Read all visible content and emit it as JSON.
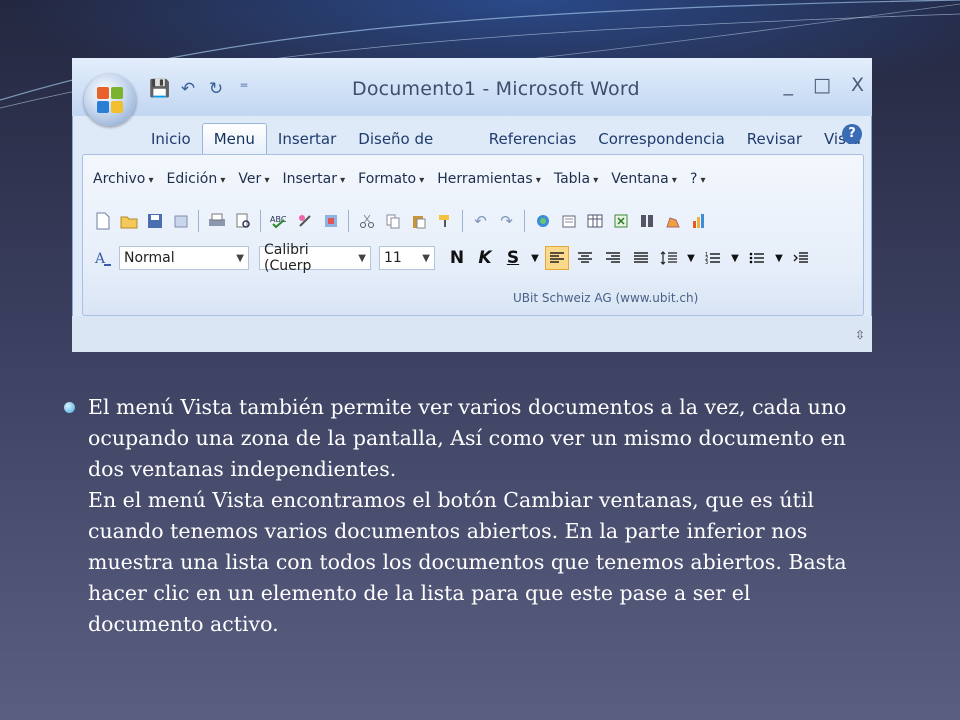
{
  "window": {
    "title": "Documento1 - Microsoft Word",
    "controls": [
      "_",
      "□",
      "X"
    ]
  },
  "quick_access": [
    {
      "name": "save-icon",
      "glyph": "💾"
    },
    {
      "name": "undo-icon",
      "glyph": "↶"
    },
    {
      "name": "redo-icon",
      "glyph": "↻"
    },
    {
      "name": "customize-icon",
      "glyph": "⁼"
    }
  ],
  "tabs": [
    "Inicio",
    "Menu",
    "Insertar",
    "Diseño de página",
    "Referencias",
    "Correspondencia",
    "Revisar",
    "Vista"
  ],
  "active_tab": "Menu",
  "help_label": "?",
  "menubar": [
    "Archivo",
    "Edición",
    "Ver",
    "Insertar",
    "Formato",
    "Herramientas",
    "Tabla",
    "Ventana",
    "?"
  ],
  "toolbar_icons": [
    "new-doc-icon",
    "open-icon",
    "save-icon",
    "permission-icon",
    "print-icon",
    "print-preview-icon",
    "spelling-icon",
    "research-icon",
    "translate-icon",
    "cut-icon",
    "copy-icon",
    "paste-icon",
    "format-painter-icon",
    "undo-icon",
    "redo-icon",
    "hyperlink-icon",
    "tables-icon",
    "insert-table-icon",
    "excel-icon",
    "columns-icon",
    "drawing-icon",
    "chart-icon"
  ],
  "format_bar": {
    "style": "Normal",
    "font": "Calibri (Cuerp",
    "size": "11",
    "bold": "N",
    "italic": "K",
    "underline": "S"
  },
  "credit": "UBit Schweiz AG (www.ubit.ch)",
  "body": {
    "lines": [
      "El menú Vista también permite ver varios documentos a la vez, cada uno",
      "ocupando una zona de la pantalla, Así como ver un mismo documento en",
      "dos ventanas independientes.",
      "En el menú Vista encontramos el botón Cambiar ventanas, que es útil",
      "cuando tenemos varios documentos abiertos. En la parte inferior nos",
      "muestra una lista con todos los documentos que tenemos abiertos. Basta",
      "hacer clic en un elemento de la lista para que este pase a ser el",
      "documento activo."
    ]
  },
  "colors": {
    "accent_bullet": "#7fc8ee",
    "text": "#ffffff"
  }
}
